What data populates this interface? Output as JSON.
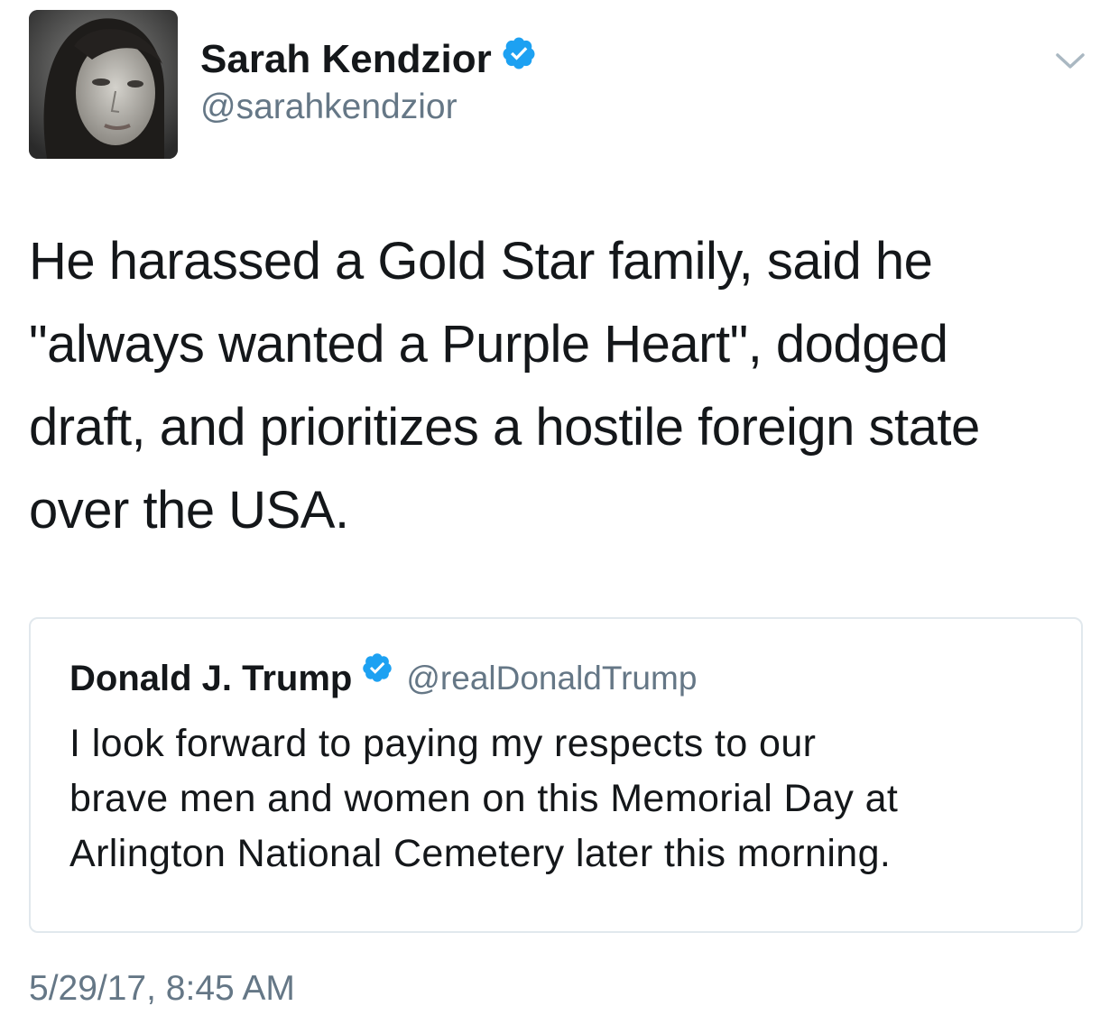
{
  "tweet": {
    "author": {
      "name": "Sarah Kendzior",
      "handle": "@sarahkendzior",
      "verified": true,
      "avatar_icon": "profile-photo"
    },
    "text_lines": [
      "He harassed a Gold Star family, said he",
      "\"always wanted a Purple Heart\", dodged",
      "draft, and prioritizes a hostile foreign state",
      "over the USA."
    ],
    "menu_icon": "chevron-down-icon",
    "timestamp": "5/29/17, 8:45 AM"
  },
  "quoted_tweet": {
    "author": {
      "name": "Donald J. Trump",
      "handle": "@realDonaldTrump",
      "verified": true
    },
    "text_lines": [
      "I look forward to paying my respects to our",
      "brave men and women on this Memorial Day at",
      "Arlington National Cemetery later this morning."
    ]
  },
  "colors": {
    "text": "#14171a",
    "secondary_text": "#657786",
    "verified_badge": "#1da1f2",
    "card_border": "#e1e8ed"
  }
}
